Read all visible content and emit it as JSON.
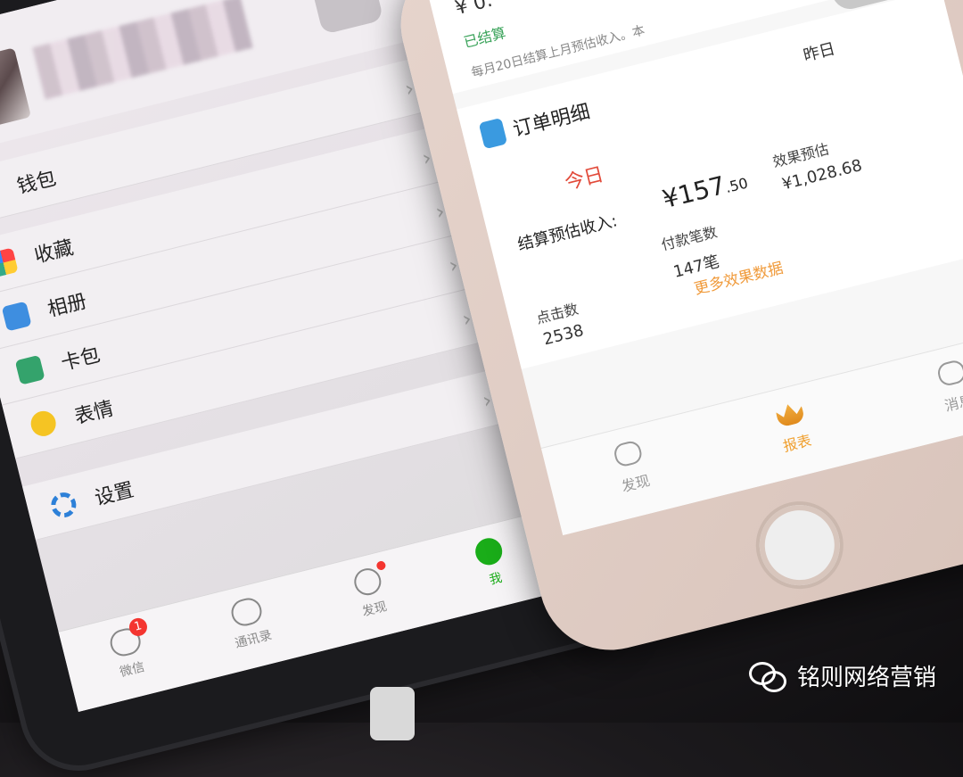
{
  "left_phone": {
    "menu": [
      {
        "label": "钱包",
        "icon": "wallet-icon"
      },
      {
        "label": "收藏",
        "icon": "favorites-icon"
      },
      {
        "label": "相册",
        "icon": "album-icon"
      },
      {
        "label": "卡包",
        "icon": "card-pack-icon"
      },
      {
        "label": "表情",
        "icon": "emoji-icon"
      },
      {
        "label": "设置",
        "icon": "gear-icon"
      }
    ],
    "tabs": [
      {
        "label": "微信",
        "badge": "1"
      },
      {
        "label": "通讯录"
      },
      {
        "label": "发现"
      },
      {
        "label": "我"
      }
    ]
  },
  "right_phone": {
    "settled_amount": "¥ 0.",
    "settled_label": "已结算",
    "settled_note": "每月20日结算上月预估收入。本",
    "order_title": "订单明细",
    "yesterday": "昨日",
    "today": "今日",
    "settle_label": "结算预估收入:",
    "settle_value": "¥157",
    "settle_cents": ".50",
    "pay_count_label": "付款笔数",
    "pay_count_value": "147笔",
    "effect_label": "效果预估",
    "effect_value": "¥1,028.68",
    "clicks_label": "点击数",
    "clicks_value": "2538",
    "more_link": "更多效果数据",
    "tabs": [
      {
        "label": "发现"
      },
      {
        "label": "报表"
      },
      {
        "label": "消息"
      }
    ]
  },
  "watermark": "铭则网络营销",
  "colors": {
    "wechat_green": "#1aad19",
    "badge_red": "#f43530",
    "accent_orange": "#f0a030",
    "today_red": "#e24a3a",
    "settled_green": "#3aa35a"
  }
}
